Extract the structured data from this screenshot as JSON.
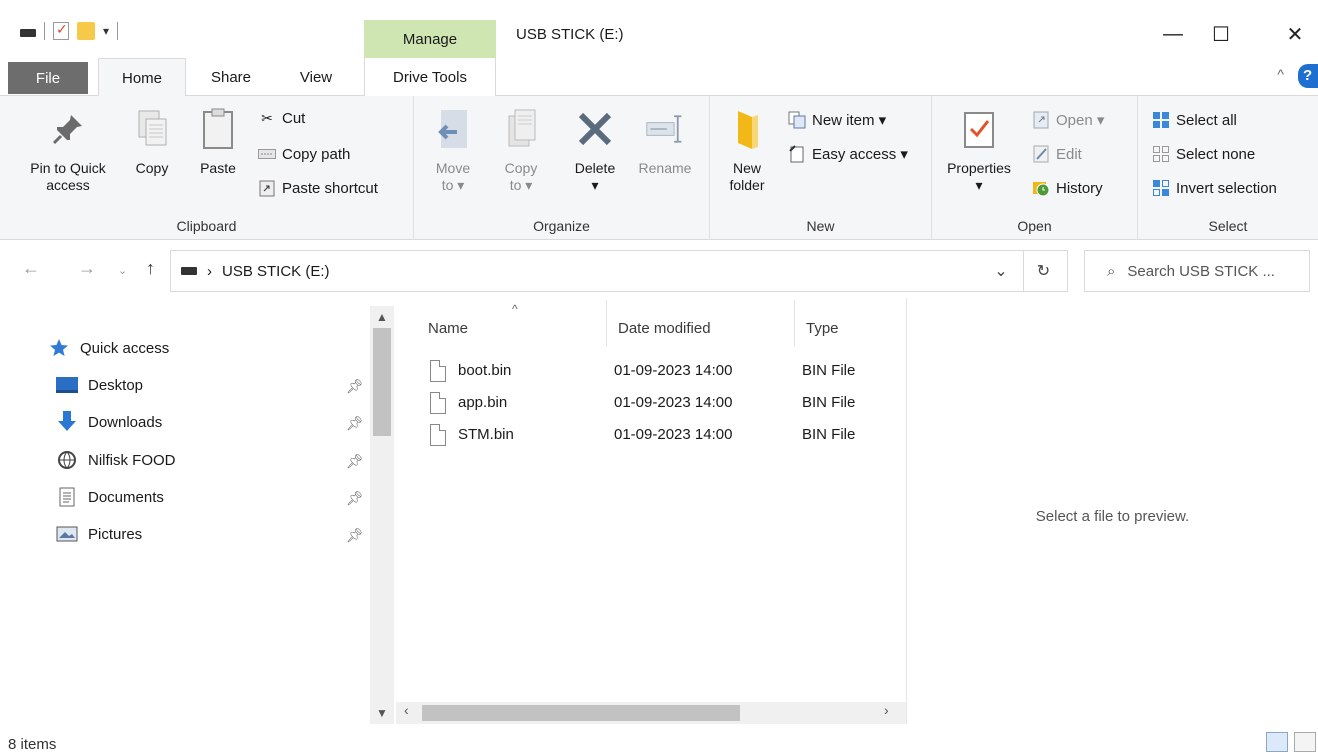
{
  "window": {
    "title": "USB STICK (E:)",
    "contextual_tab_group": "Manage",
    "minimize": "—",
    "maximize": "☐",
    "close": "✕"
  },
  "tabs": {
    "file": "File",
    "home": "Home",
    "share": "Share",
    "view": "View",
    "drive_tools": "Drive Tools"
  },
  "ribbon": {
    "clipboard": {
      "label": "Clipboard",
      "pin_line1": "Pin to Quick",
      "pin_line2": "access",
      "copy": "Copy",
      "paste": "Paste",
      "cut": "Cut",
      "copy_path": "Copy path",
      "paste_shortcut": "Paste shortcut"
    },
    "organize": {
      "label": "Organize",
      "move_line1": "Move",
      "move_line2": "to ▾",
      "copy_line1": "Copy",
      "copy_line2": "to ▾",
      "delete": "Delete",
      "delete_arrow": "▾",
      "rename": "Rename"
    },
    "new": {
      "label": "New",
      "new_folder_line1": "New",
      "new_folder_line2": "folder",
      "new_item": "New item ▾",
      "easy_access": "Easy access ▾"
    },
    "open": {
      "label": "Open",
      "properties": "Properties",
      "properties_arrow": "▾",
      "open": "Open ▾",
      "edit": "Edit",
      "history": "History"
    },
    "select": {
      "label": "Select",
      "select_all": "Select all",
      "select_none": "Select none",
      "invert_selection": "Invert selection"
    }
  },
  "address": {
    "path": "USB STICK (E:)",
    "separator": "›",
    "search_placeholder": "Search USB STICK ..."
  },
  "nav_pane": {
    "quick_access": "Quick access",
    "items": [
      {
        "label": "Desktop",
        "icon": "desktop-icon"
      },
      {
        "label": "Downloads",
        "icon": "downloads-icon"
      },
      {
        "label": "Nilfisk FOOD",
        "icon": "network-folder-icon"
      },
      {
        "label": "Documents",
        "icon": "documents-icon"
      },
      {
        "label": "Pictures",
        "icon": "pictures-icon"
      }
    ]
  },
  "file_list": {
    "columns": {
      "name": "Name",
      "date": "Date modified",
      "type": "Type"
    },
    "rows": [
      {
        "name": "boot.bin",
        "date": "01-09-2023 14:00",
        "type": "BIN File"
      },
      {
        "name": "app.bin",
        "date": "01-09-2023 14:00",
        "type": "BIN File"
      },
      {
        "name": "STM.bin",
        "date": "01-09-2023 14:00",
        "type": "BIN File"
      }
    ]
  },
  "preview": {
    "message": "Select a file to preview."
  },
  "status": {
    "items_count": "8 items"
  },
  "colors": {
    "manage_tab": "#cfe6b3",
    "file_tab": "#6d6d6d",
    "ribbon_bg": "#f5f6f7",
    "accent_blue": "#1f6fd1"
  }
}
